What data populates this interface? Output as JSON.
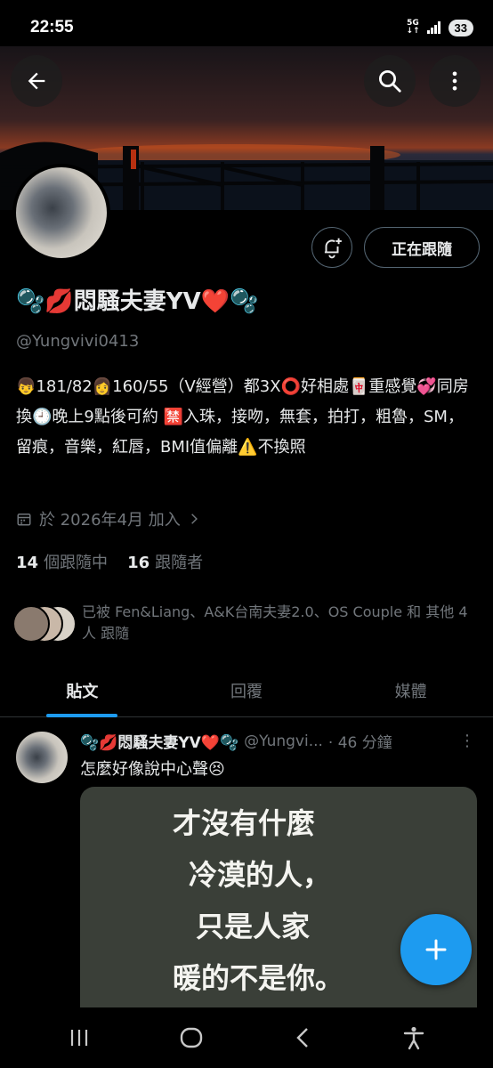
{
  "status_bar": {
    "time": "22:55",
    "network": "5G",
    "battery": "33"
  },
  "profile": {
    "name": "🫧💋悶騷夫妻YV❤️🫧",
    "handle": "@Yungvivi0413",
    "bio": "👦181/82👩160/55（V經營）都3X⭕好相處🀄重感覺💞同房換🕘晚上9點後可約 🈲入珠，接吻，無套，拍打，粗魯，SM，留痕，音樂，紅唇，BMI值偏離⚠️不換照",
    "joined": "於 2026年4月 加入",
    "following_count": "14",
    "following_label": "個跟隨中",
    "followers_count": "16",
    "followers_label": "跟隨者",
    "followed_by": "已被 Fen&Liang、A&K台南夫妻2.0、OS Couple 和 其他 4 人 跟隨",
    "follow_button": "正在跟隨"
  },
  "tabs": [
    {
      "label": "貼文",
      "active": true
    },
    {
      "label": "回覆",
      "active": false
    },
    {
      "label": "媒體",
      "active": false
    }
  ],
  "tweet": {
    "name": "🫧💋悶騷夫妻YV❤️🫧",
    "handle": "@Yungvi...",
    "time": "· 46 分鐘",
    "text": "怎麼好像說中心聲😣",
    "image_lines": [
      "才沒有什麼",
      "冷漠的人，",
      "只是人家",
      "暖的不是你。"
    ]
  },
  "icons": {
    "back": "arrow-left-icon",
    "search": "search-icon",
    "more": "more-vertical-icon",
    "bell": "bell-plus-icon",
    "calendar": "calendar-icon",
    "compose": "plus-icon"
  },
  "colors": {
    "accent": "#1d9bf0",
    "secondary_text": "#71767b",
    "border": "#536471"
  }
}
